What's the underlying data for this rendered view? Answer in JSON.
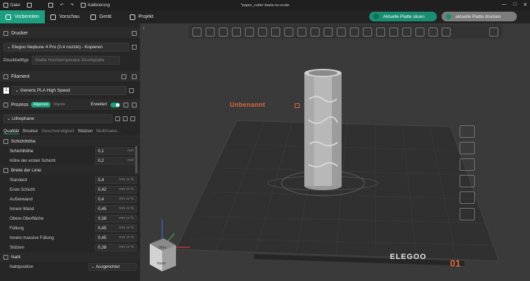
{
  "titlebar": {
    "file_label": "Datei",
    "calibration_label": "Kalibrierung",
    "title": "*paper_cutter-basis-no-scale",
    "win_min": "—",
    "win_max": "□",
    "win_close": "✕"
  },
  "tabs": [
    {
      "label": "Vorbereiten"
    },
    {
      "label": "Vorschau"
    },
    {
      "label": "Gerät"
    },
    {
      "label": "Projekt"
    }
  ],
  "actions": {
    "slice_label": "Aktuelle Platte slicen",
    "print_label": "aktuelle Platte drucken"
  },
  "sidebar": {
    "printer_header": "Drucker",
    "printer_value": "Elegoo Neptune 4 Pro (0.4 nozzle) - Kopieren",
    "bed_type_label": "Druckbetttyp",
    "bed_type_value": "Glatte Hochtemperatur-Druckplatte",
    "filament_header": "Filament",
    "filament_index": "1",
    "filament_value": "Generic PLA High Speed",
    "process_header": "Prozess",
    "process_mode_global": "Allgemein",
    "process_mode_object": "Objekte",
    "advanced_label": "Erweitert",
    "process_value": "Lithophane",
    "quality_tabs": [
      "Qualität",
      "Struktur",
      "Geschwindigkeit",
      "Stützen",
      "Multimater..."
    ],
    "groups": {
      "layer_height": "Schichthöhe",
      "line_width": "Breite der Linie",
      "seam": "Naht"
    },
    "params_layer": [
      {
        "label": "Schichthöhe",
        "value": "0,1",
        "unit": "mm"
      },
      {
        "label": "Höhe der ersten Schicht",
        "value": "0,2",
        "unit": "mm"
      }
    ],
    "params_width": [
      {
        "label": "Standard",
        "value": "0,4",
        "unit": "mm or %"
      },
      {
        "label": "Erste Schicht",
        "value": "0,42",
        "unit": "mm or %"
      },
      {
        "label": "Außenwand",
        "value": "0,4",
        "unit": "mm or %"
      },
      {
        "label": "Innere Wand",
        "value": "0,45",
        "unit": "mm or %"
      },
      {
        "label": "Obere Oberfläche",
        "value": "0,38",
        "unit": "mm or %"
      },
      {
        "label": "Füllung",
        "value": "0,45",
        "unit": "mm or %"
      },
      {
        "label": "Innere massive Füllung",
        "value": "0,45",
        "unit": "mm or %"
      },
      {
        "label": "Stützen",
        "value": "0,38",
        "unit": "mm or %"
      }
    ],
    "seam_param": {
      "label": "Nahtposition",
      "value": "Ausgerichtet"
    }
  },
  "viewport": {
    "plate_label": "Unbenannt",
    "brand": "ELEGOO",
    "plate_number": "01",
    "cube_front": "Vorne",
    "cube_top": "Oben",
    "colors": {
      "accent": "#1d9e7e",
      "plate_label": "#e06a3b",
      "plate_number": "#e06a3b"
    }
  }
}
